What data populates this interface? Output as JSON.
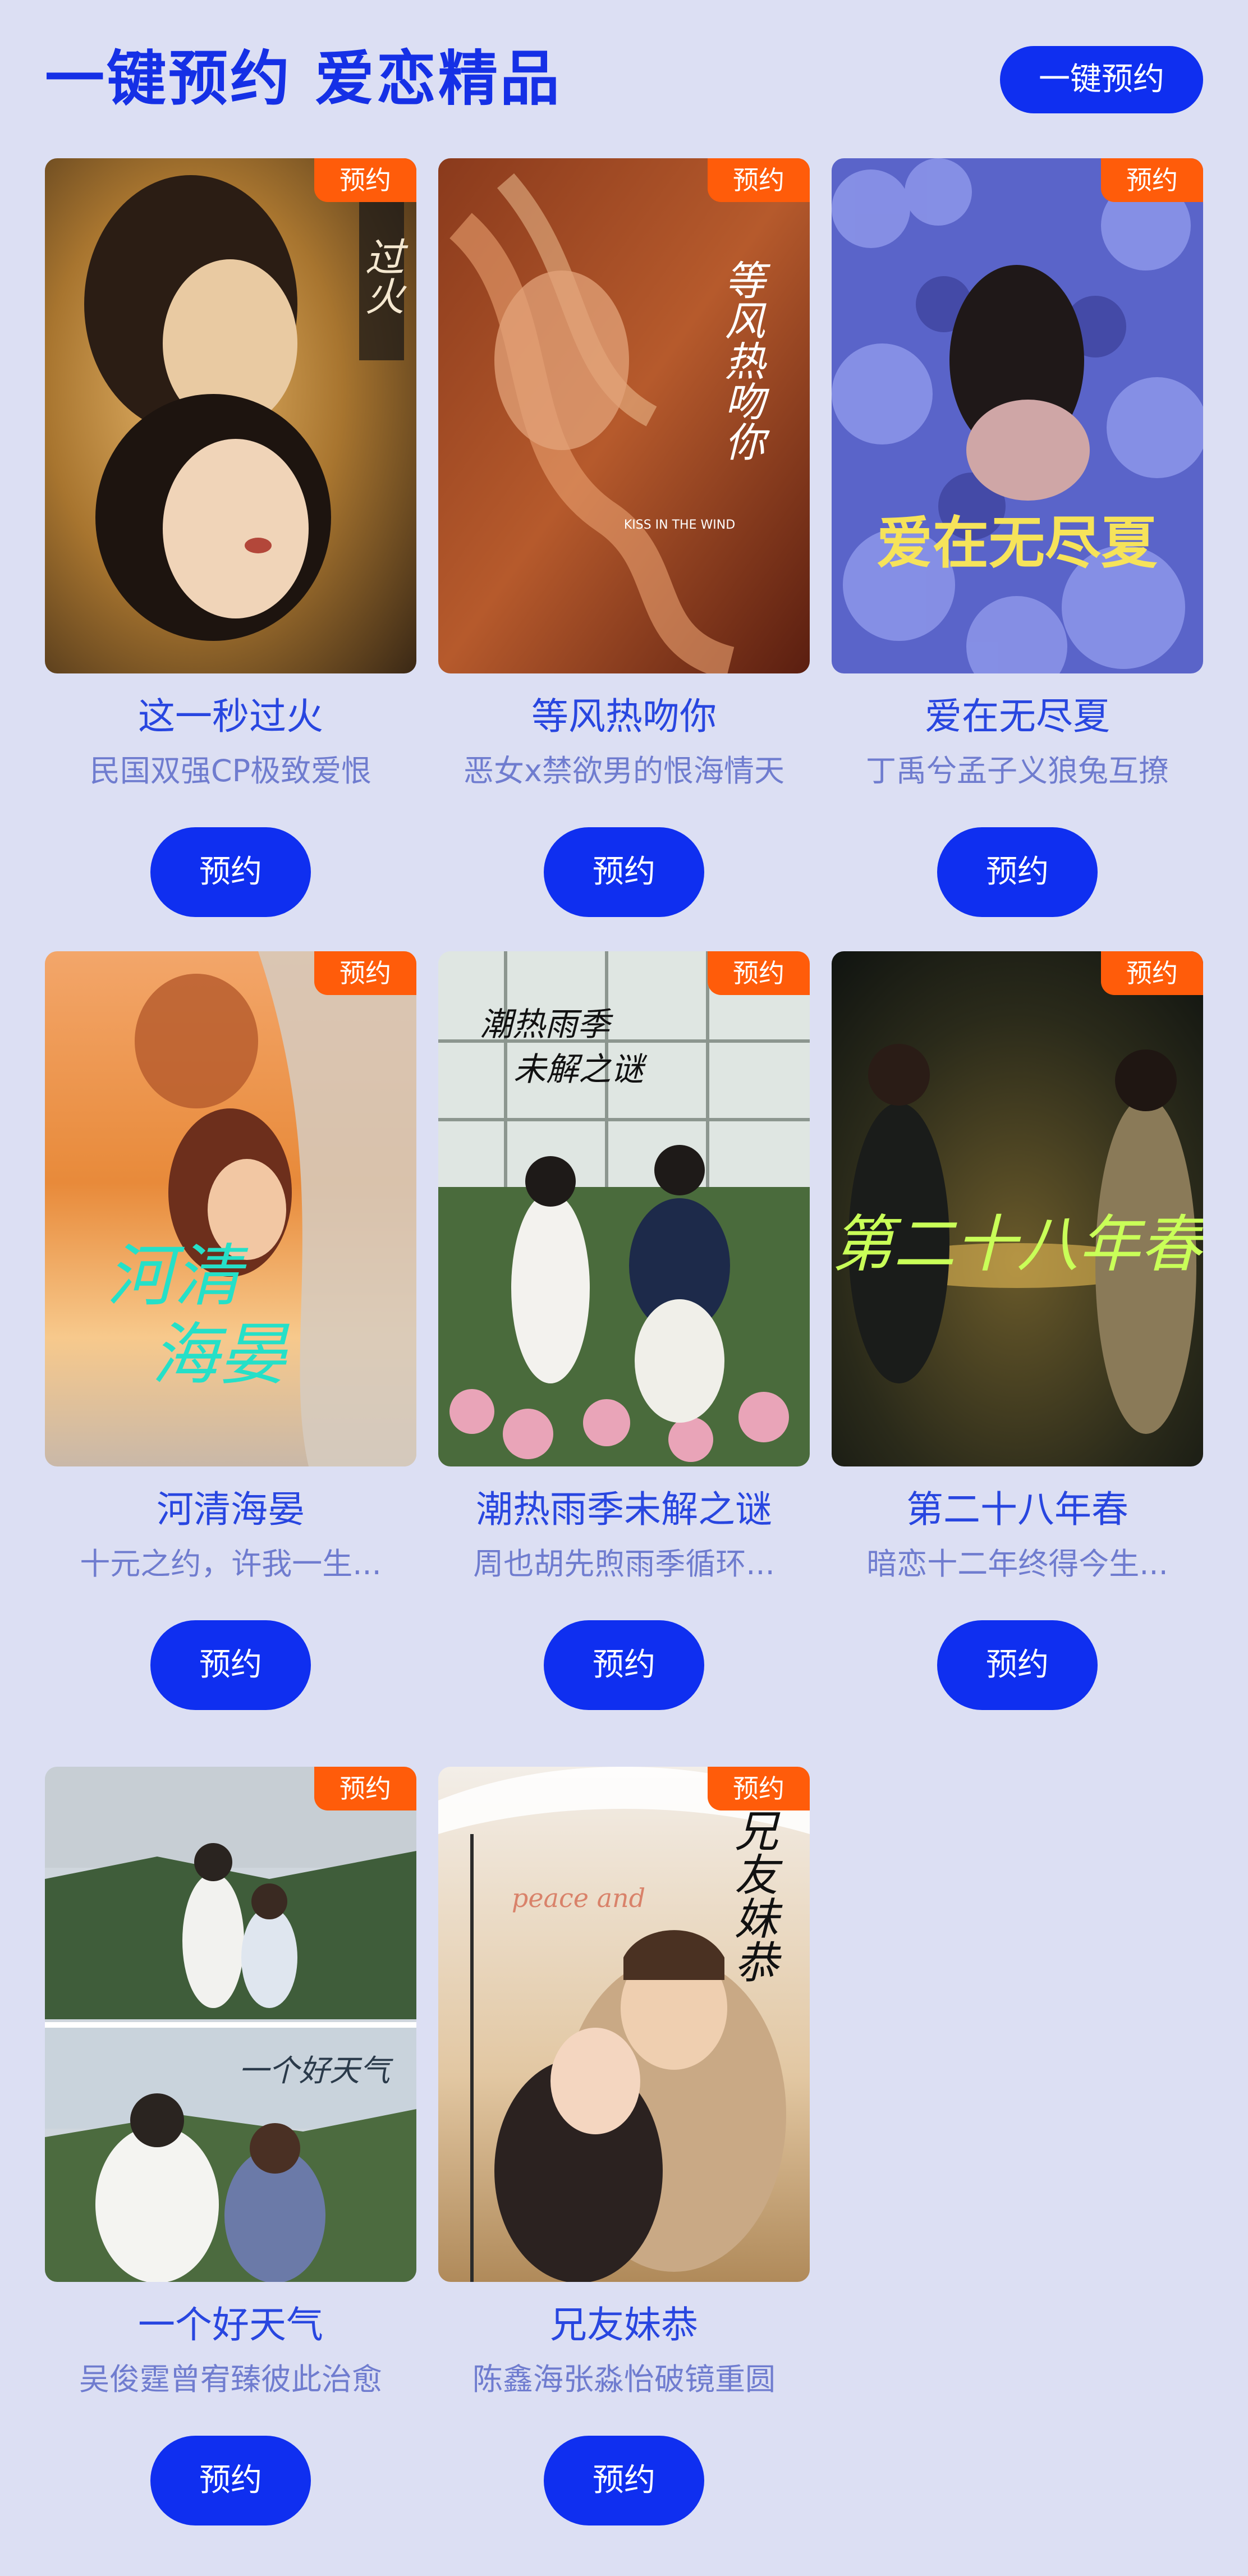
{
  "header": {
    "title": "一键预约 爱恋精品",
    "button_label": "一键预约"
  },
  "cards": [
    {
      "title": "这一秒过火",
      "desc": "民国双强CP极致爱恨",
      "badge": "预约",
      "button": "预约",
      "poster_text": "这一秒过火",
      "poster_icon": "couple-portrait-poster"
    },
    {
      "title": "等风热吻你",
      "desc": "恶女x禁欲男的恨海情天",
      "badge": "预约",
      "button": "预约",
      "poster_text": "等风热吻你",
      "poster_sub": "KISS IN THE WIND",
      "poster_icon": "red-silk-poster"
    },
    {
      "title": "爱在无尽夏",
      "desc": "丁禹兮孟子义狼兔互撩",
      "badge": "预约",
      "button": "预约",
      "poster_text": "爱在无尽夏",
      "poster_icon": "hydrangea-poster"
    },
    {
      "title": "河清海晏",
      "desc": "十元之约，许我一生...",
      "badge": "预约",
      "button": "预约",
      "poster_text": "河清海晏",
      "poster_icon": "sunset-couple-poster"
    },
    {
      "title": "潮热雨季未解之谜",
      "desc": "周也胡先煦雨季循环...",
      "badge": "预约",
      "button": "预约",
      "poster_text": "潮热雨季未解之谜",
      "poster_icon": "greenhouse-garden-poster"
    },
    {
      "title": "第二十八年春",
      "desc": "暗恋十二年终得今生...",
      "badge": "预约",
      "button": "预约",
      "poster_text": "第二十八年春",
      "poster_icon": "night-street-poster"
    },
    {
      "title": "一个好天气",
      "desc": "吴俊霆曾宥臻彼此治愈",
      "badge": "预约",
      "button": "预约",
      "poster_text": "一个好天气",
      "poster_icon": "grassland-couple-poster"
    },
    {
      "title": "兄友妹恭",
      "desc": "陈鑫海张淼怡破镜重圆",
      "badge": "预约",
      "button": "预约",
      "poster_text": "兄友妹恭",
      "poster_sub": "peace and",
      "poster_icon": "umbrella-couple-poster"
    }
  ],
  "colors": {
    "page_background": "#dcdff3",
    "accent_blue": "#0f2ff0",
    "title_blue": "#1530e6",
    "badge_orange": "#ff5c0a",
    "desc_gray_blue": "#6f7ccf"
  }
}
